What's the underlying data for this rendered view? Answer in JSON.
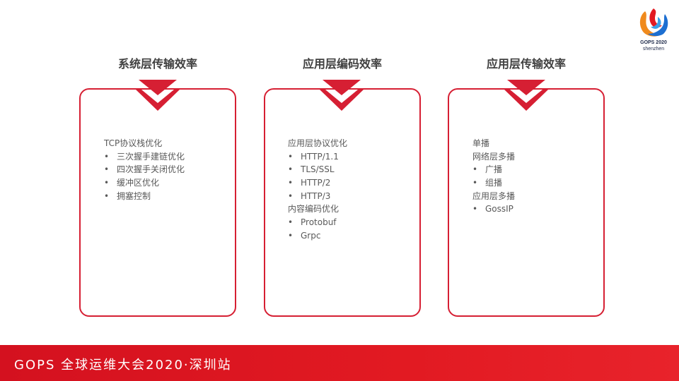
{
  "logo": {
    "name": "gops-flame-logo-icon",
    "line1": "GOPS 2020",
    "line2": "shenzhen"
  },
  "colors": {
    "accent": "#d61f33",
    "footer": "#e21a22",
    "title_text": "#404040",
    "body_text": "#595959"
  },
  "columns": [
    {
      "title": "系统层传输效率",
      "items": [
        {
          "text": "TCP协议栈优化",
          "bullet": false
        },
        {
          "text": "三次握手建链优化",
          "bullet": true
        },
        {
          "text": "四次握手关闭优化",
          "bullet": true
        },
        {
          "text": "缓冲区优化",
          "bullet": true
        },
        {
          "text": "拥塞控制",
          "bullet": true
        }
      ]
    },
    {
      "title": "应用层编码效率",
      "items": [
        {
          "text": "应用层协议优化",
          "bullet": false
        },
        {
          "text": "HTTP/1.1",
          "bullet": true
        },
        {
          "text": "TLS/SSL",
          "bullet": true
        },
        {
          "text": "HTTP/2",
          "bullet": true
        },
        {
          "text": "HTTP/3",
          "bullet": true
        },
        {
          "text": "内容编码优化",
          "bullet": false
        },
        {
          "text": "Protobuf",
          "bullet": true
        },
        {
          "text": "Grpc",
          "bullet": true
        }
      ]
    },
    {
      "title": "应用层传输效率",
      "items": [
        {
          "text": "单播",
          "bullet": false
        },
        {
          "text": "网络层多播",
          "bullet": false
        },
        {
          "text": "广播",
          "bullet": true
        },
        {
          "text": "组播",
          "bullet": true
        },
        {
          "text": "应用层多播",
          "bullet": false
        },
        {
          "text": "GossIP",
          "bullet": true
        }
      ]
    }
  ],
  "bullet_char": "•",
  "footer": {
    "text": "GOPS 全球运维大会2020·深圳站"
  }
}
